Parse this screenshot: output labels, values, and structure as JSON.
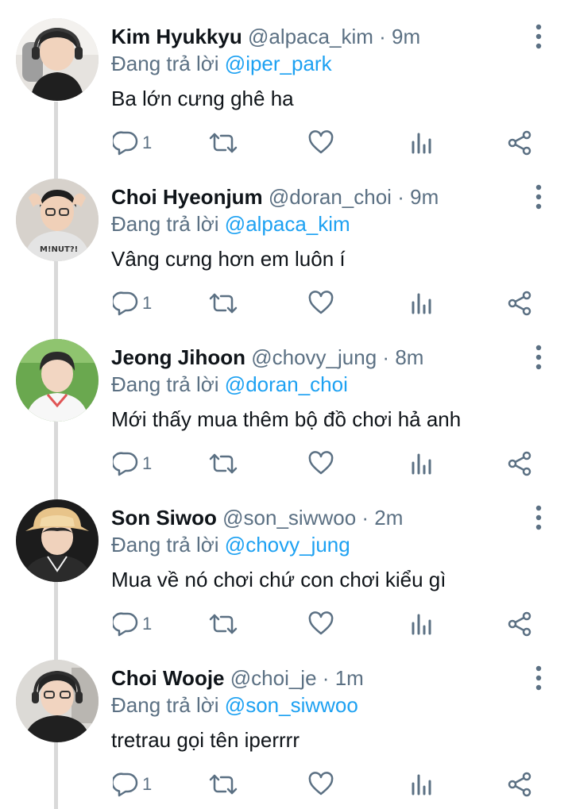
{
  "colors": {
    "name": "#0f1419",
    "muted": "#5b7083",
    "mention": "#1da1f2",
    "thread_line": "#d9d9d9"
  },
  "tweets": [
    {
      "name": "Kim Hyukkyu",
      "handle": "@alpaca_kim",
      "time": "9m",
      "reply_prefix": "Đang trả lời",
      "reply_to": "@iper_park",
      "text": "Ba lớn cưng ghê ha",
      "reply_count": "1"
    },
    {
      "name": "Choi Hyeonjum",
      "handle": "@doran_choi",
      "time": "9m",
      "reply_prefix": "Đang trả lời",
      "reply_to": "@alpaca_kim",
      "text": "Vâng cưng hơn em luôn í",
      "reply_count": "1"
    },
    {
      "name": "Jeong Jihoon",
      "handle": "@chovy_jung",
      "time": "8m",
      "reply_prefix": "Đang trả lời",
      "reply_to": "@doran_choi",
      "text": "Mới thấy mua thêm bộ đồ chơi hả anh",
      "reply_count": "1"
    },
    {
      "name": "Son Siwoo",
      "handle": "@son_siwwoo",
      "time": "2m",
      "reply_prefix": "Đang trả lời",
      "reply_to": "@chovy_jung",
      "text": "Mua về nó chơi chứ con chơi kiểu gì",
      "reply_count": "1"
    },
    {
      "name": "Choi Wooje",
      "handle": "@choi_je",
      "time": "1m",
      "reply_prefix": "Đang trả lời",
      "reply_to": "@son_siwwoo",
      "text": "tretrau gọi tên iperrrr",
      "reply_count": "1"
    }
  ],
  "icons": {
    "more": "more-vertical-icon",
    "reply": "reply-bubble-icon",
    "retweet": "retweet-icon",
    "like": "heart-icon",
    "stats": "bar-chart-icon",
    "share": "share-icon"
  }
}
